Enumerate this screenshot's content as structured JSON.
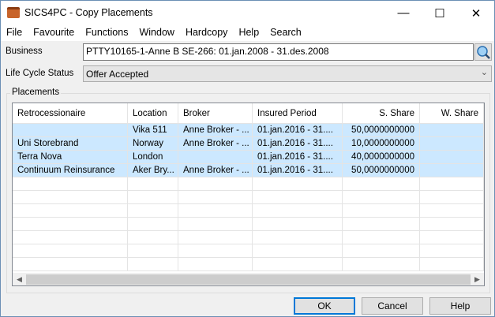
{
  "window": {
    "title": "SICS4PC - Copy Placements",
    "minimize": "—",
    "maximize": "☐",
    "close": "✕"
  },
  "menu": [
    "File",
    "Favourite",
    "Functions",
    "Window",
    "Hardcopy",
    "Help",
    "Search"
  ],
  "form": {
    "business_label": "Business",
    "business_value": "PTTY10165-1-Anne B SE-266: 01.jan.2008  -  31.des.2008",
    "status_label": "Life Cycle Status",
    "status_value": "Offer Accepted"
  },
  "placements": {
    "group_label": "Placements",
    "columns": [
      "Retrocessionaire",
      "Location",
      "Broker",
      "Insured Period",
      "S. Share",
      "W. Share"
    ],
    "rows": [
      [
        "",
        "Vika 511",
        "Anne Broker - ...",
        "01.jan.2016  -  31....",
        "50,0000000000",
        ""
      ],
      [
        "Uni Storebrand",
        "Norway",
        "Anne Broker - ...",
        "01.jan.2016  -  31....",
        "10,0000000000",
        ""
      ],
      [
        "Terra Nova",
        "London",
        "",
        "01.jan.2016  -  31....",
        "40,0000000000",
        ""
      ],
      [
        "Continuum Reinsurance",
        "Aker Bry...",
        "Anne Broker - ...",
        "01.jan.2016  -  31....",
        "50,0000000000",
        ""
      ]
    ]
  },
  "buttons": {
    "ok": "OK",
    "cancel": "Cancel",
    "help": "Help"
  }
}
